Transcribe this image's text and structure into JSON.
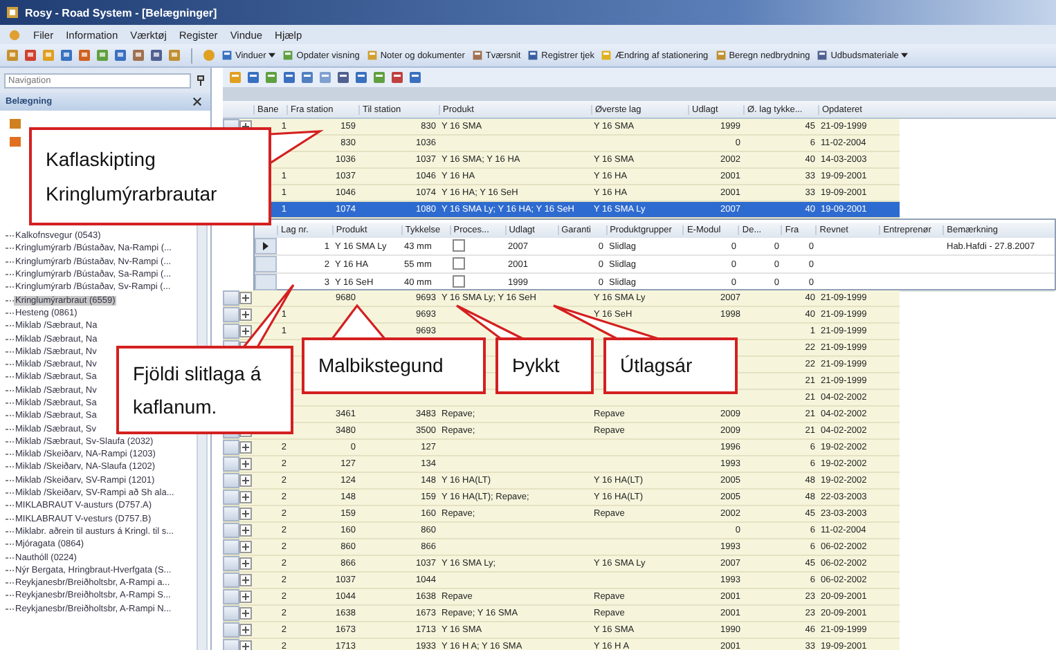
{
  "window": {
    "title": "Rosy - Road System - [Belægninger]"
  },
  "menu": [
    "Filer",
    "Information",
    "Værktøj",
    "Register",
    "Vindue",
    "Hjælp"
  ],
  "toolbar": {
    "buttons": [
      {
        "label": "Vinduer",
        "dropdown": true
      },
      {
        "label": "Opdater visning",
        "dropdown": false
      },
      {
        "label": "Noter og dokumenter",
        "dropdown": false
      },
      {
        "label": "Tværsnit",
        "dropdown": false
      },
      {
        "label": "Registrer tjek",
        "dropdown": false
      },
      {
        "label": "Ændring af stationering",
        "dropdown": false
      },
      {
        "label": "Beregn nedbrydning",
        "dropdown": false
      },
      {
        "label": "Udbudsmateriale",
        "dropdown": true
      }
    ]
  },
  "sidebar": {
    "search_placeholder": "Navigation",
    "panel_title": "Belægning",
    "items": [
      {
        "label": "Kalkofnsvegur (0543)",
        "selected": false
      },
      {
        "label": "Kringlumýrarb /Bústaðav, Na-Rampi (...",
        "selected": false
      },
      {
        "label": "Kringlumýrarb /Bústaðav, Nv-Rampi (...",
        "selected": false
      },
      {
        "label": "Kringlumýrarb /Bústaðav, Sa-Rampi (...",
        "selected": false
      },
      {
        "label": "Kringlumýrarb /Bústaðav, Sv-Rampi (...",
        "selected": false
      },
      {
        "label": "Kringlumýrarbraut (6559)",
        "selected": true
      },
      {
        "label": "Hesteng (0861)",
        "selected": false
      },
      {
        "label": "Miklab /Sæbraut, Na",
        "selected": false
      },
      {
        "label": "Miklab /Sæbraut, Na",
        "selected": false
      },
      {
        "label": "Miklab /Sæbraut, Nv",
        "selected": false
      },
      {
        "label": "Miklab /Sæbraut, Nv",
        "selected": false
      },
      {
        "label": "Miklab /Sæbraut, Sa",
        "selected": false
      },
      {
        "label": "Miklab /Sæbraut, Nv",
        "selected": false
      },
      {
        "label": "Miklab /Sæbraut, Sa",
        "selected": false
      },
      {
        "label": "Miklab /Sæbraut, Sa",
        "selected": false
      },
      {
        "label": "Miklab /Sæbraut, Sv",
        "selected": false
      },
      {
        "label": "Miklab /Sæbraut, Sv-Slaufa (2032)",
        "selected": false
      },
      {
        "label": "Miklab /Skeiðarv, NA-Rampi (1203)",
        "selected": false
      },
      {
        "label": "Miklab /Skeiðarv, NA-Slaufa (1202)",
        "selected": false
      },
      {
        "label": "Miklab /Skeiðarv, SV-Rampi (1201)",
        "selected": false
      },
      {
        "label": "Miklab /Skeiðarv, SV-Rampi að Sh ala...",
        "selected": false
      },
      {
        "label": "MIKLABRAUT V-austurs (D757.A)",
        "selected": false
      },
      {
        "label": "MIKLABRAUT V-vesturs (D757.B)",
        "selected": false
      },
      {
        "label": "Miklabr. aðrein til austurs á Kringl. til s...",
        "selected": false
      },
      {
        "label": "Mjóragata (0864)",
        "selected": false
      },
      {
        "label": "Nauthóll (0224)",
        "selected": false
      },
      {
        "label": "Nýr Bergata, Hringbraut-Hverfgata (S...",
        "selected": false
      },
      {
        "label": "Reykjanesbr/Breiðholtsbr, A-Rampi a...",
        "selected": false
      },
      {
        "label": "Reykjanesbr/Breiðholtsbr, A-Rampi S...",
        "selected": false
      },
      {
        "label": "Reykjanesbr/Breiðholtsbr, A-Rampi N...",
        "selected": false
      }
    ]
  },
  "grid": {
    "columns": [
      "Bane",
      "Fra station",
      "Til station",
      "Produkt",
      "Øverste lag",
      "Udlagt",
      "Ø. lag tykke...",
      "Opdateret"
    ],
    "rows": [
      {
        "cells": [
          "1",
          "159",
          "830",
          "Y 16 SMA",
          "Y 16 SMA",
          "1999",
          "45",
          "21-09-1999"
        ],
        "selected": false
      },
      {
        "cells": [
          null,
          "830",
          "1036",
          null,
          null,
          "0",
          "6",
          "11-02-2004"
        ],
        "selected": false
      },
      {
        "cells": [
          null,
          "1036",
          "1037",
          "Y 16 SMA; Y 16 HA",
          "Y 16 SMA",
          "2002",
          "40",
          "14-03-2003"
        ],
        "selected": false
      },
      {
        "cells": [
          "1",
          "1037",
          "1046",
          "Y 16 HA",
          "Y 16 HA",
          "2001",
          "33",
          "19-09-2001"
        ],
        "selected": false
      },
      {
        "cells": [
          "1",
          "1046",
          "1074",
          "Y 16 HA; Y 16 SeH",
          "Y 16 HA",
          "2001",
          "33",
          "19-09-2001"
        ],
        "selected": false
      },
      {
        "cells": [
          "1",
          "1074",
          "1080",
          "Y 16 SMA Ly; Y 16 HA; Y 16 SeH",
          "Y 16 SMA Ly",
          "2007",
          "40",
          "19-09-2001"
        ],
        "selected": true,
        "detail": {
          "columns": [
            "Lag nr.",
            "Produkt",
            "Tykkelse",
            "Proces...",
            "Udlagt",
            "Garanti",
            "Produktgrupper",
            "E-Modul",
            "De...",
            "Fra",
            "Revnet",
            "Entreprenør",
            "Bemærkning"
          ],
          "rows": [
            {
              "current": true,
              "checked": false,
              "cells": [
                "1",
                "Y 16 SMA Ly",
                "43 mm",
                null,
                "2007",
                "0",
                "Slidlag",
                "0",
                "0",
                "0",
                null,
                null,
                "Hab.Hafdi - 27.8.2007"
              ]
            },
            {
              "current": false,
              "checked": false,
              "cells": [
                "2",
                "Y 16 HA",
                "55 mm",
                null,
                "2001",
                "0",
                "Slidlag",
                "0",
                "0",
                "0",
                null,
                null,
                null
              ]
            },
            {
              "current": false,
              "checked": false,
              "cells": [
                "3",
                "Y 16 SeH",
                "40 mm",
                null,
                "1999",
                "0",
                "Slidlag",
                "0",
                "0",
                "0",
                null,
                null,
                null
              ]
            }
          ]
        }
      },
      {
        "cells": [
          null,
          "9680",
          "9693",
          "Y 16 SMA Ly; Y 16 SeH",
          "Y 16 SMA Ly",
          "2007",
          "40",
          "21-09-1999"
        ],
        "selected": false
      },
      {
        "cells": [
          "1",
          null,
          "9693",
          null,
          "Y 16 SeH",
          "1998",
          "40",
          "21-09-1999"
        ],
        "selected": false
      },
      {
        "cells": [
          "1",
          null,
          "9693",
          null,
          null,
          null,
          "1",
          "21-09-1999"
        ],
        "selected": false
      },
      {
        "cells": [
          null,
          null,
          null,
          null,
          null,
          null,
          "22",
          "21-09-1999"
        ],
        "selected": false
      },
      {
        "cells": [
          null,
          null,
          null,
          null,
          null,
          null,
          "22",
          "21-09-1999"
        ],
        "selected": false
      },
      {
        "cells": [
          null,
          null,
          null,
          null,
          null,
          null,
          "21",
          "21-09-1999"
        ],
        "selected": false
      },
      {
        "cells": [
          null,
          null,
          null,
          null,
          null,
          null,
          "21",
          "04-02-2002"
        ],
        "selected": false
      },
      {
        "cells": [
          null,
          "3461",
          "3483",
          "Repave;",
          "Repave",
          "2009",
          "21",
          "04-02-2002"
        ],
        "selected": false
      },
      {
        "cells": [
          null,
          "3480",
          "3500",
          "Repave;",
          "Repave",
          "2009",
          "21",
          "04-02-2002"
        ],
        "selected": false
      },
      {
        "cells": [
          "2",
          "0",
          "127",
          null,
          null,
          "1996",
          "6",
          "19-02-2002"
        ],
        "selected": false
      },
      {
        "cells": [
          "2",
          "127",
          "134",
          null,
          null,
          "1993",
          "6",
          "19-02-2002"
        ],
        "selected": false
      },
      {
        "cells": [
          "2",
          "124",
          "148",
          "Y 16 HA(LT)",
          "Y 16 HA(LT)",
          "2005",
          "48",
          "19-02-2002"
        ],
        "selected": false
      },
      {
        "cells": [
          "2",
          "148",
          "159",
          "Y 16 HA(LT); Repave;",
          "Y 16 HA(LT)",
          "2005",
          "48",
          "22-03-2003"
        ],
        "selected": false
      },
      {
        "cells": [
          "2",
          "159",
          "160",
          "Repave;",
          "Repave",
          "2002",
          "45",
          "23-03-2003"
        ],
        "selected": false
      },
      {
        "cells": [
          "2",
          "160",
          "860",
          null,
          null,
          "0",
          "6",
          "11-02-2004"
        ],
        "selected": false
      },
      {
        "cells": [
          "2",
          "860",
          "866",
          null,
          null,
          "1993",
          "6",
          "06-02-2002"
        ],
        "selected": false
      },
      {
        "cells": [
          "2",
          "866",
          "1037",
          "Y 16 SMA Ly;",
          "Y 16 SMA Ly",
          "2007",
          "45",
          "06-02-2002"
        ],
        "selected": false
      },
      {
        "cells": [
          "2",
          "1037",
          "1044",
          null,
          null,
          "1993",
          "6",
          "06-02-2002"
        ],
        "selected": false
      },
      {
        "cells": [
          "2",
          "1044",
          "1638",
          "Repave",
          "Repave",
          "2001",
          "23",
          "20-09-2001"
        ],
        "selected": false
      },
      {
        "cells": [
          "2",
          "1638",
          "1673",
          "Repave; Y 16 SMA",
          "Repave",
          "2001",
          "23",
          "20-09-2001"
        ],
        "selected": false
      },
      {
        "cells": [
          "2",
          "1673",
          "1713",
          "Y 16 SMA",
          "Y 16 SMA",
          "1990",
          "46",
          "21-09-1999"
        ],
        "selected": false
      },
      {
        "cells": [
          "2",
          "1713",
          "1933",
          "Y 16 H A; Y 16 SMA",
          "Y 16 H A",
          "2001",
          "33",
          "19-09-2001"
        ],
        "selected": false
      }
    ]
  },
  "callouts": [
    {
      "text": "Kaflaskipting Kringlumýrarbrautar"
    },
    {
      "text": "Fjöldi  slitlaga á kaflanum."
    },
    {
      "text": "Malbikstegund"
    },
    {
      "text": "Þykkt"
    },
    {
      "text": "Útlagsár"
    }
  ]
}
